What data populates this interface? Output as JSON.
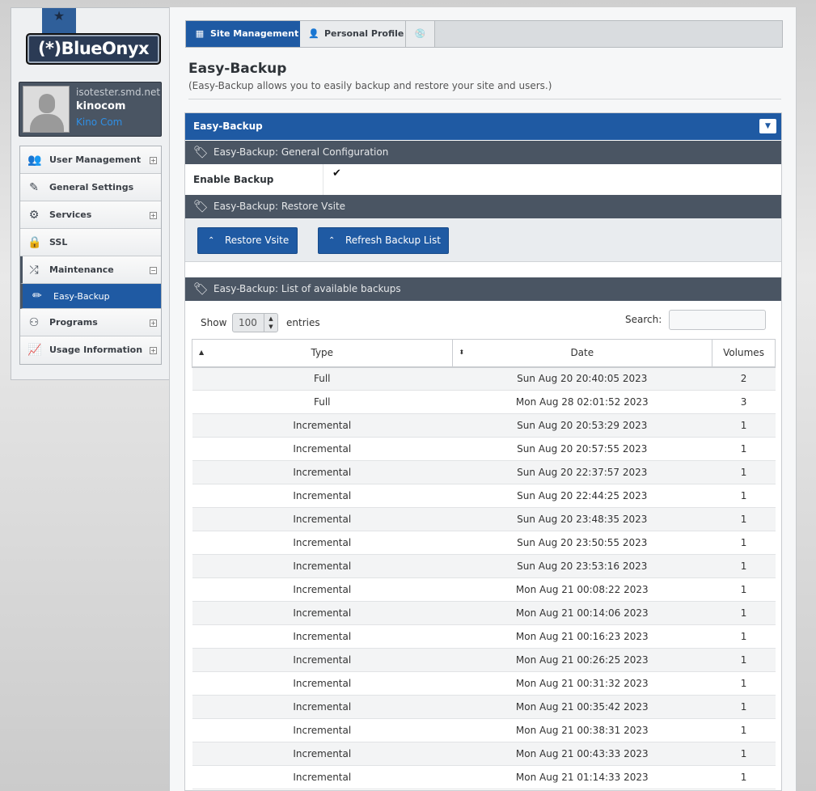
{
  "brand": {
    "logo_text": "(*)BlueOnyx"
  },
  "user": {
    "host": "isotester.smd.net",
    "username": "kinocom",
    "fullname": "Kino Com"
  },
  "menu": {
    "items": [
      {
        "label": "User Management",
        "icon": "users-icon",
        "toggle": "+"
      },
      {
        "label": "General Settings",
        "icon": "edit-icon",
        "toggle": ""
      },
      {
        "label": "Services",
        "icon": "gear-icon",
        "toggle": "+"
      },
      {
        "label": "SSL",
        "icon": "lock-icon",
        "toggle": ""
      },
      {
        "label": "Maintenance",
        "icon": "shuffle-icon",
        "toggle": "−"
      },
      {
        "label": "Programs",
        "icon": "robot-icon",
        "toggle": "+"
      },
      {
        "label": "Usage Information",
        "icon": "chart-line-icon",
        "toggle": "+"
      }
    ],
    "active_subitem": {
      "label": "Easy-Backup",
      "icon": "pencil-icon"
    }
  },
  "tabs": {
    "site": "Site Management",
    "profile": "Personal Profile"
  },
  "page": {
    "title": "Easy-Backup",
    "description": "(Easy-Backup allows you to easily backup and restore your site and users.)"
  },
  "panel": {
    "title": "Easy-Backup",
    "general_section": "Easy-Backup: General Configuration",
    "enable_label": "Enable Backup",
    "enable_value": "✔",
    "restore_section": "Easy-Backup: Restore Vsite",
    "restore_button": "Restore Vsite",
    "refresh_button": "Refresh Backup List",
    "list_section": "Easy-Backup: List of available backups"
  },
  "datatable": {
    "show_label": "Show",
    "entries_value": "100",
    "entries_label": "entries",
    "search_label": "Search:",
    "search_value": "",
    "columns": [
      "Type",
      "Date",
      "Volumes"
    ],
    "rows": [
      [
        "Full",
        "Sun Aug 20 20:40:05 2023",
        "2"
      ],
      [
        "Full",
        "Mon Aug 28 02:01:52 2023",
        "3"
      ],
      [
        "Incremental",
        "Sun Aug 20 20:53:29 2023",
        "1"
      ],
      [
        "Incremental",
        "Sun Aug 20 20:57:55 2023",
        "1"
      ],
      [
        "Incremental",
        "Sun Aug 20 22:37:57 2023",
        "1"
      ],
      [
        "Incremental",
        "Sun Aug 20 22:44:25 2023",
        "1"
      ],
      [
        "Incremental",
        "Sun Aug 20 23:48:35 2023",
        "1"
      ],
      [
        "Incremental",
        "Sun Aug 20 23:50:55 2023",
        "1"
      ],
      [
        "Incremental",
        "Sun Aug 20 23:53:16 2023",
        "1"
      ],
      [
        "Incremental",
        "Mon Aug 21 00:08:22 2023",
        "1"
      ],
      [
        "Incremental",
        "Mon Aug 21 00:14:06 2023",
        "1"
      ],
      [
        "Incremental",
        "Mon Aug 21 00:16:23 2023",
        "1"
      ],
      [
        "Incremental",
        "Mon Aug 21 00:26:25 2023",
        "1"
      ],
      [
        "Incremental",
        "Mon Aug 21 00:31:32 2023",
        "1"
      ],
      [
        "Incremental",
        "Mon Aug 21 00:35:42 2023",
        "1"
      ],
      [
        "Incremental",
        "Mon Aug 21 00:38:31 2023",
        "1"
      ],
      [
        "Incremental",
        "Mon Aug 21 00:43:33 2023",
        "1"
      ],
      [
        "Incremental",
        "Mon Aug 21 01:14:33 2023",
        "1"
      ]
    ]
  },
  "colors": {
    "accent": "#1f5aa3",
    "section": "#4a5563",
    "link": "#2f8fe5"
  }
}
